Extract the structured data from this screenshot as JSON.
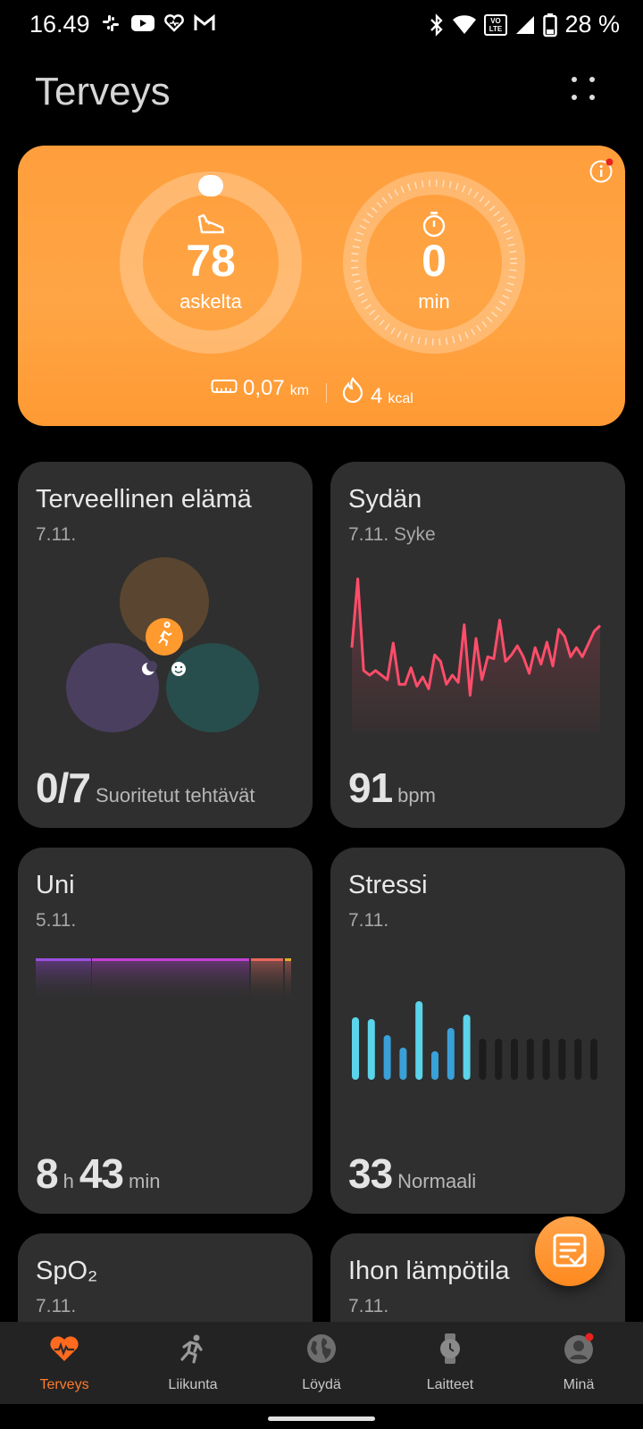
{
  "status_bar": {
    "time": "16.49",
    "battery": "28 %",
    "icons": [
      "slack-icon",
      "youtube-icon",
      "health-heart-icon",
      "gmail-icon",
      "bluetooth-icon",
      "wifi-icon",
      "volte-icon",
      "signal-icon",
      "battery-icon"
    ]
  },
  "header": {
    "title": "Terveys",
    "menu_icon": "more-dots-icon"
  },
  "activity": {
    "steps_value": "78",
    "steps_unit": "askelta",
    "time_value": "0",
    "time_unit": "min",
    "distance_value": "0,07",
    "distance_unit": "km",
    "calories_value": "4",
    "calories_unit": "kcal",
    "colors": {
      "card": "#ffa545"
    }
  },
  "tiles": {
    "health": {
      "title": "Terveellinen elämä",
      "date": "7.11.",
      "value": "0/7",
      "label": "Suoritetut tehtävät"
    },
    "heart": {
      "title": "Sydän",
      "date": "7.11. Syke",
      "value": "91",
      "unit": "bpm",
      "series": [
        70,
        145,
        45,
        40,
        45,
        40,
        35,
        75,
        30,
        30,
        48,
        28,
        38,
        25,
        62,
        55,
        30,
        40,
        32,
        95,
        18,
        80,
        35,
        60,
        58,
        100,
        55,
        62,
        72,
        60,
        42,
        70,
        52,
        76,
        50,
        90,
        82,
        60,
        70,
        60,
        74,
        88,
        94
      ]
    },
    "sleep": {
      "title": "Uni",
      "date": "5.11.",
      "hours": "8",
      "h_unit": "h",
      "minutes": "43",
      "min_unit": "min"
    },
    "stress": {
      "title": "Stressi",
      "date": "7.11.",
      "value": "33",
      "label": "Normaali",
      "bars": [
        70,
        68,
        50,
        36,
        88,
        32,
        58,
        73
      ]
    },
    "spo2": {
      "title": "SpO₂",
      "date": "7.11."
    },
    "temp": {
      "title": "Ihon lämpötila",
      "date": "7.11."
    }
  },
  "fab": {
    "icon": "task-list-icon"
  },
  "nav": [
    {
      "label": "Terveys",
      "icon": "heart-pulse-icon",
      "active": true
    },
    {
      "label": "Liikunta",
      "icon": "running-icon",
      "active": false
    },
    {
      "label": "Löydä",
      "icon": "globe-icon",
      "active": false
    },
    {
      "label": "Laitteet",
      "icon": "watch-icon",
      "active": false
    },
    {
      "label": "Minä",
      "icon": "profile-icon",
      "active": false
    }
  ],
  "colors": {
    "accent": "#ff7b2c",
    "heart_line": "#ff4d6a",
    "stress_bar": "#4fc3f7",
    "tile_bg": "#2f2f2f"
  }
}
